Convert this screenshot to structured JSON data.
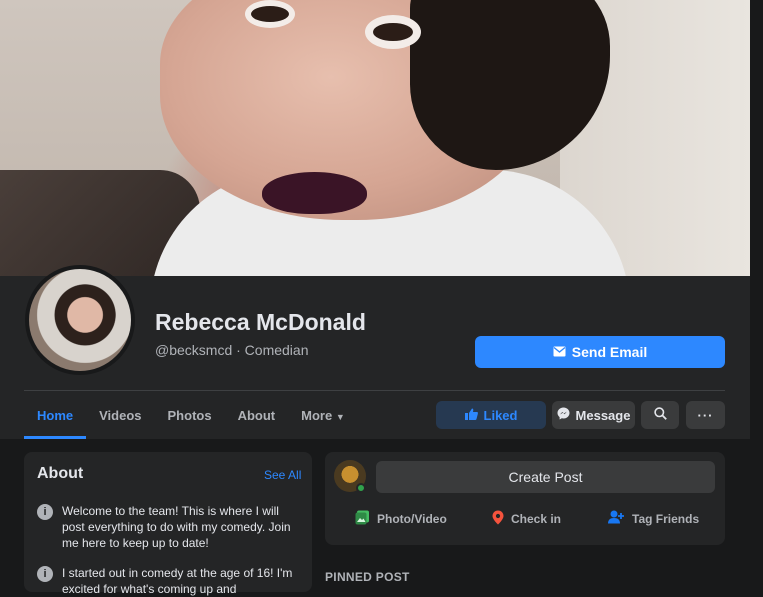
{
  "profile": {
    "name": "Rebecca McDonald",
    "handle_line": "@becksmcd · Comedian",
    "send_email_label": "Send Email"
  },
  "tabs": [
    {
      "label": "Home",
      "active": true
    },
    {
      "label": "Videos"
    },
    {
      "label": "Photos"
    },
    {
      "label": "About"
    },
    {
      "label": "More"
    }
  ],
  "actions": {
    "liked_label": "Liked",
    "message_label": "Message"
  },
  "about": {
    "title": "About",
    "see_all": "See All",
    "items": [
      "Welcome to the team! This is where I will post everything to do with my comedy. Join me here to keep up to date!",
      "I started out in comedy at the age of 16! I'm excited for what's coming up and"
    ]
  },
  "composer": {
    "create_post": "Create Post",
    "photo_video": "Photo/Video",
    "check_in": "Check in",
    "tag_friends": "Tag Friends"
  },
  "pinned_label": "PINNED POST",
  "colors": {
    "accent": "#2d88ff",
    "background": "#18191a",
    "surface": "#242526",
    "button": "#3a3b3c"
  }
}
